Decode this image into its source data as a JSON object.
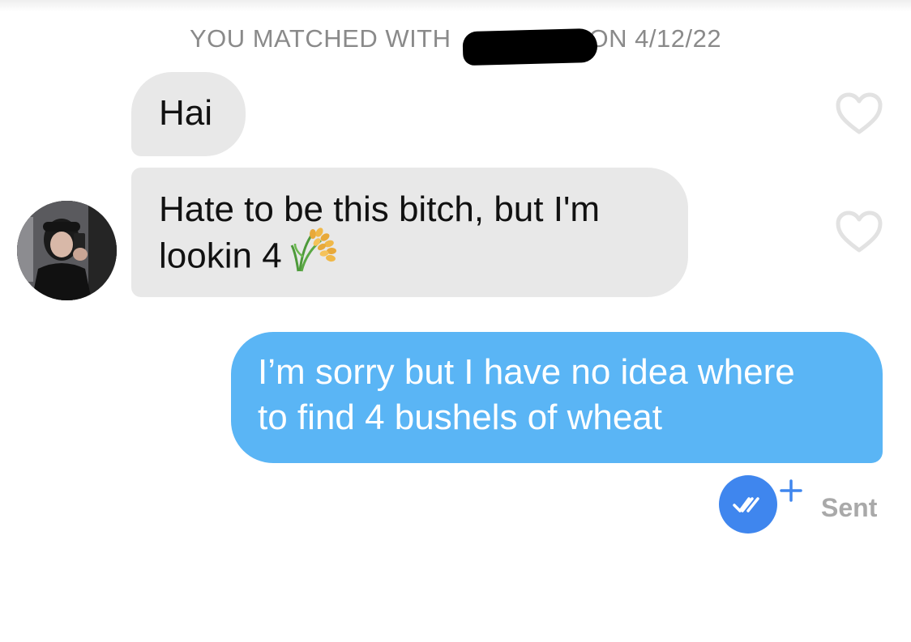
{
  "header": {
    "match_text_before": "YOU MATCHED WITH",
    "match_text_after": "ON 4/12/22"
  },
  "messages": [
    {
      "direction": "incoming",
      "text": "Hai",
      "liked": false
    },
    {
      "direction": "incoming",
      "text": "Hate to be this bitch, but I'm\nlookin 4",
      "emoji": "rice-sheaf-icon",
      "liked": false
    },
    {
      "direction": "outgoing",
      "text": "I’m sorry but I have no idea where\nto find 4 bushels of wheat"
    }
  ],
  "status": {
    "label": "Sent",
    "read_icon": "double-check-icon",
    "extra_icon": "plus-icon"
  },
  "colors": {
    "incoming_bubble": "#e8e8e8",
    "outgoing_bubble": "#5ab5f5",
    "read_badge": "#3f86ee",
    "header_text": "#8a8a8a",
    "status_text": "#a9a9a9"
  }
}
